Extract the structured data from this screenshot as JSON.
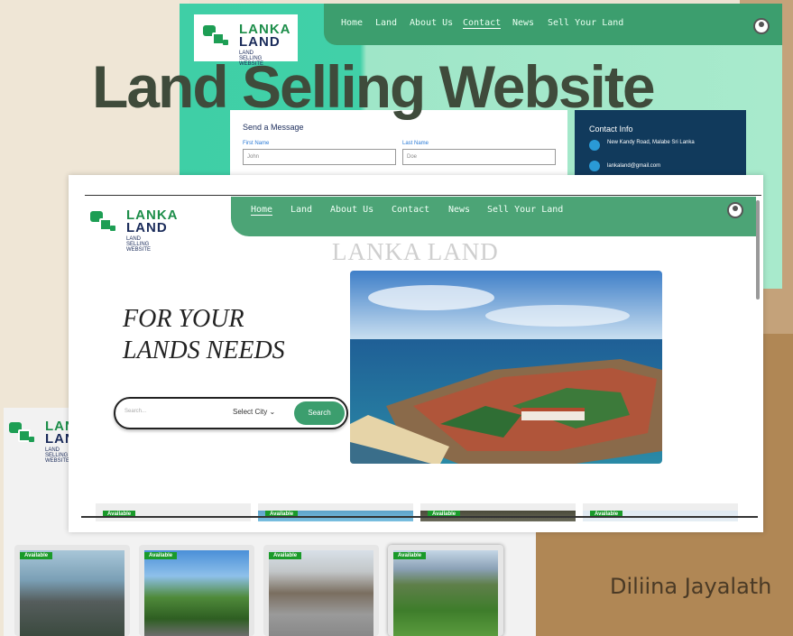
{
  "title": "Land Selling Website",
  "author": "Diliina Jayalath",
  "brand": {
    "word1": "LANKA",
    "word2": "LAND",
    "subtitle": "LAND SELLING WEBSITE"
  },
  "main": {
    "nav": [
      "Home",
      "Land",
      "About Us",
      "Contact",
      "News",
      "Sell Your Land"
    ],
    "brand_heading": "LANKA LAND",
    "hero_line1": "FOR YOUR",
    "hero_line2": "LANDS NEEDS",
    "search_placeholder": "Search...",
    "city_select": "Select City",
    "search_button": "Search",
    "badges": [
      "Available",
      "Available",
      "Available",
      "Available"
    ]
  },
  "contact": {
    "nav": [
      "Home",
      "Land",
      "About Us",
      "Contact",
      "News",
      "Sell Your Land"
    ],
    "form_title": "Send a Message",
    "first_name_label": "First Name",
    "first_name_value": "John",
    "last_name_label": "Last Name",
    "last_name_value": "Doe",
    "info_title": "Contact Info",
    "address": "New Kandy Road, Malabe Sri Lanka",
    "email": "lankaland@gmail.com"
  },
  "listing": {
    "badges": [
      "Available",
      "Available",
      "Available",
      "Available"
    ]
  },
  "colors": {
    "primary": "#4ca476",
    "title": "#3f4b3b",
    "badge": "#1a9a2a"
  }
}
